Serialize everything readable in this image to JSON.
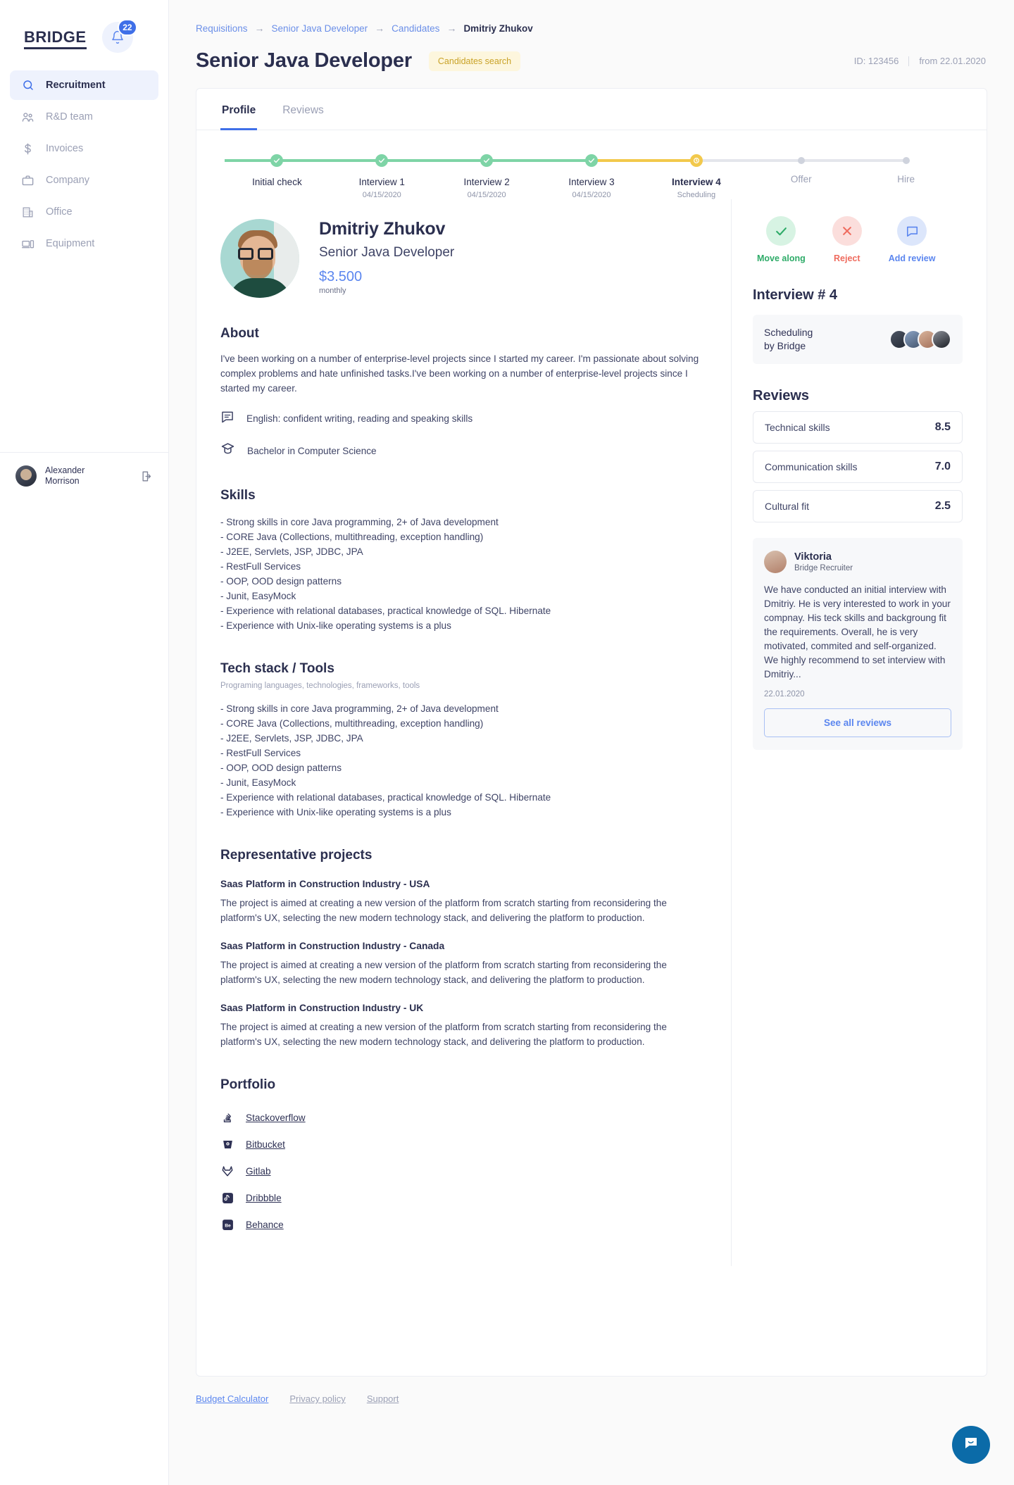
{
  "sidebar": {
    "logo": "BRIDGE",
    "notifications_badge": "22",
    "items": [
      {
        "label": "Recruitment",
        "icon": "search-icon",
        "active": true
      },
      {
        "label": "R&D team",
        "icon": "people-icon",
        "active": false
      },
      {
        "label": "Invoices",
        "icon": "dollar-icon",
        "active": false
      },
      {
        "label": "Company",
        "icon": "briefcase-icon",
        "active": false
      },
      {
        "label": "Office",
        "icon": "building-icon",
        "active": false
      },
      {
        "label": "Equipment",
        "icon": "devices-icon",
        "active": false
      }
    ],
    "user": {
      "name_line1": "Alexander",
      "name_line2": "Morrison",
      "logout_icon": "logout-icon"
    }
  },
  "breadcrumb": {
    "items": [
      "Requisitions",
      "Senior Java Developer",
      "Candidates"
    ],
    "current": "Dmitriy Zhukov",
    "separator": "→"
  },
  "header": {
    "title": "Senior Java Developer",
    "chip": "Candidates search",
    "id": "ID: 123456",
    "date": "from 22.01.2020"
  },
  "tabs": [
    {
      "label": "Profile",
      "active": true
    },
    {
      "label": "Reviews",
      "active": false
    }
  ],
  "stepper": [
    {
      "label": "Initial check",
      "sub": "",
      "state": "done"
    },
    {
      "label": "Interview 1",
      "sub": "04/15/2020",
      "state": "done"
    },
    {
      "label": "Interview 2",
      "sub": "04/15/2020",
      "state": "done"
    },
    {
      "label": "Interview 3",
      "sub": "04/15/2020",
      "state": "done"
    },
    {
      "label": "Interview 4",
      "sub": "Scheduling",
      "state": "current"
    },
    {
      "label": "Offer",
      "sub": "",
      "state": "future"
    },
    {
      "label": "Hire",
      "sub": "",
      "state": "future"
    }
  ],
  "candidate": {
    "name": "Dmitriy Zhukov",
    "role": "Senior Java Developer",
    "salary": "$3.500",
    "salary_period": "monthly"
  },
  "about": {
    "heading": "About",
    "text": "I've been working on a number of enterprise-level projects since I started my career.  I'm passionate about solving complex problems  and hate unfinished tasks.I've been working on a number of enterprise-level projects since I started my career.",
    "language": "English: confident writing, reading and speaking skills",
    "education": "Bachelor in Computer Science"
  },
  "skills": {
    "heading": "Skills",
    "items": [
      "- Strong skills in core Java programming, 2+ of Java development",
      "- CORE Java (Collections, multithreading, exception handling)",
      "- J2EE, Servlets, JSP, JDBC, JPA",
      "- RestFull Services",
      "- OOP, OOD design patterns",
      "- Junit, EasyMock",
      "- Experience with relational databases, practical knowledge of SQL. Hibernate",
      "- Experience with Unix-like operating systems is a plus"
    ]
  },
  "techstack": {
    "heading": "Tech stack / Tools",
    "subheading": "Programing languages, technologies, frameworks, tools",
    "items": [
      "- Strong skills in core Java programming, 2+ of Java development",
      "- CORE Java (Collections, multithreading, exception handling)",
      "- J2EE, Servlets, JSP, JDBC, JPA",
      "- RestFull Services",
      "- OOP, OOD design patterns",
      "- Junit, EasyMock",
      "- Experience with relational databases, practical knowledge of SQL. Hibernate",
      "- Experience with Unix-like operating systems is a plus"
    ]
  },
  "projects": {
    "heading": "Representative projects",
    "items": [
      {
        "title": "Saas Platform in Construction Industry - USA",
        "desc": "The project is aimed at creating a new version of the platform from scratch starting from reconsidering the platform's UX, selecting the new modern technology stack, and delivering the platform to production."
      },
      {
        "title": "Saas Platform in Construction Industry - Canada",
        "desc": "The project is aimed at creating a new version of the platform from scratch starting from reconsidering the platform's UX, selecting the new modern technology stack, and delivering the platform to production."
      },
      {
        "title": "Saas Platform in Construction Industry - UK",
        "desc": "The project is aimed at creating a new version of the platform from scratch starting from reconsidering the platform's UX, selecting the new modern technology stack, and delivering the platform to production."
      }
    ]
  },
  "portfolio": {
    "heading": "Portfolio",
    "items": [
      {
        "label": "Stackoverflow ",
        "icon": "stackoverflow-icon"
      },
      {
        "label": "Bitbucket ",
        "icon": "bitbucket-icon"
      },
      {
        "label": "Gitlab ",
        "icon": "gitlab-icon"
      },
      {
        "label": "Dribbble ",
        "icon": "dribbble-icon"
      },
      {
        "label": "Behance",
        "icon": "behance-icon"
      }
    ]
  },
  "actions": [
    {
      "label": "Move along",
      "icon": "check-icon",
      "color": "#2eab68"
    },
    {
      "label": "Reject",
      "icon": "close-icon",
      "color": "#ef6b5e"
    },
    {
      "label": "Add review",
      "icon": "comment-icon",
      "color": "#5b86ef"
    }
  ],
  "interview": {
    "heading": "Interview # 4",
    "status_line1": "Scheduling",
    "status_line2": "by Bridge",
    "attendees_count": 4
  },
  "reviews": {
    "heading": "Reviews",
    "scores": [
      {
        "label": "Technical skills",
        "value": "8.5"
      },
      {
        "label": "Communication skills",
        "value": "7.0"
      },
      {
        "label": "Cultural fit",
        "value": "2.5"
      }
    ],
    "review": {
      "author": "Viktoria",
      "author_role": "Bridge Recruiter",
      "text": "We have conducted an initial interview with Dmitriy. He is very interested to work in your compnay. His teck skills and backgroung fit the requirements. Overall, he is very motivated, commited and self-organized. We highly recommend to set interview with Dmitriy...",
      "date": "22.01.2020",
      "see_all_label": "See all reviews"
    }
  },
  "footer": {
    "links": [
      {
        "label": "Budget Calculator",
        "style": "blue"
      },
      {
        "label": "Privacy policy",
        "style": "gray"
      },
      {
        "label": "Support",
        "style": "gray"
      }
    ]
  },
  "chat": {
    "icon": "chat-icon"
  }
}
